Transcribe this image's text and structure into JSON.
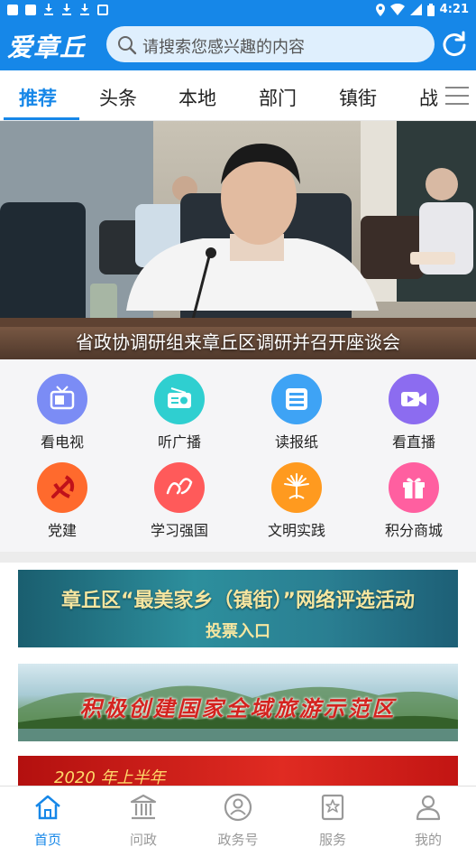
{
  "status_bar": {
    "time": "4:21"
  },
  "header": {
    "logo": "爱章丘",
    "search_placeholder": "请搜索您感兴趣的内容"
  },
  "tabs": [
    {
      "label": "推荐",
      "active": true
    },
    {
      "label": "头条"
    },
    {
      "label": "本地"
    },
    {
      "label": "部门"
    },
    {
      "label": "镇街"
    },
    {
      "label": "战"
    }
  ],
  "banner": {
    "caption": "省政协调研组来章丘区调研并召开座谈会"
  },
  "grid": [
    {
      "label": "看电视",
      "icon": "tv-icon",
      "color": "#7b8cf5"
    },
    {
      "label": "听广播",
      "icon": "radio-icon",
      "color": "#2fcfd0"
    },
    {
      "label": "读报纸",
      "icon": "newspaper-icon",
      "color": "#3ea3f5"
    },
    {
      "label": "看直播",
      "icon": "live-video-icon",
      "color": "#8c6cf0"
    },
    {
      "label": "党建",
      "icon": "party-icon",
      "color": "#ff6a2d"
    },
    {
      "label": "学习强国",
      "icon": "xuexi-icon",
      "color": "#ff5a5a"
    },
    {
      "label": "文明实践",
      "icon": "civilization-icon",
      "color": "#ff9a1f"
    },
    {
      "label": "积分商城",
      "icon": "gift-icon",
      "color": "#ff5fa0"
    }
  ],
  "ads": {
    "ad1_line1": "章丘区“最美家乡（镇街）”网络评选活动",
    "ad1_line2": "投票入口",
    "ad2": "积极创建国家全域旅游示范区",
    "ad3": "2020 年上半年"
  },
  "bottom_nav": [
    {
      "label": "首页",
      "icon": "home-icon",
      "active": true
    },
    {
      "label": "问政",
      "icon": "government-icon"
    },
    {
      "label": "政务号",
      "icon": "gov-account-icon"
    },
    {
      "label": "服务",
      "icon": "service-icon"
    },
    {
      "label": "我的",
      "icon": "profile-icon"
    }
  ]
}
